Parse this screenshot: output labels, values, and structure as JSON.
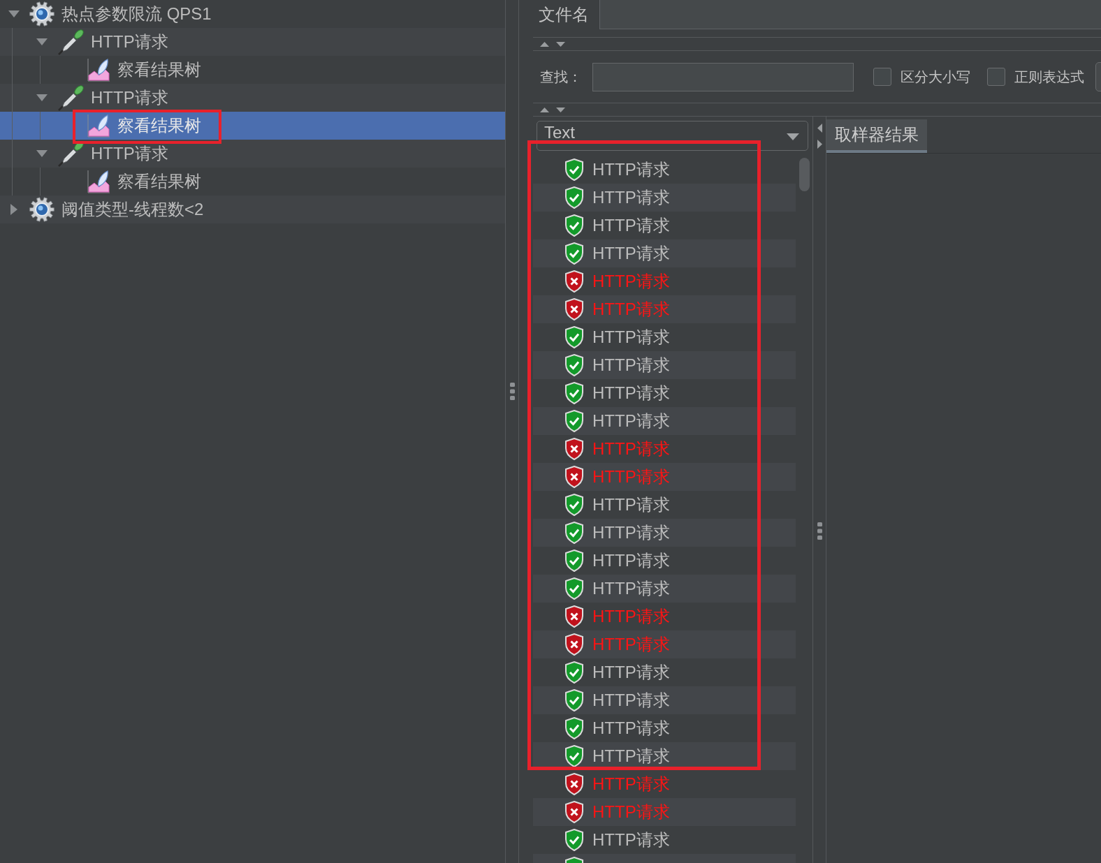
{
  "tree": {
    "items": [
      {
        "kind": "thread-group",
        "label": "热点参数限流 QPS1",
        "expanded": true,
        "selected": false,
        "annotated": false,
        "children": [
          {
            "kind": "http-request",
            "label": "HTTP请求",
            "expanded": true,
            "selected": false,
            "annotated": false,
            "children": [
              {
                "kind": "result-tree",
                "label": "察看结果树",
                "selected": false,
                "annotated": false
              }
            ]
          },
          {
            "kind": "http-request",
            "label": "HTTP请求",
            "expanded": true,
            "selected": false,
            "annotated": false,
            "children": [
              {
                "kind": "result-tree",
                "label": "察看结果树",
                "selected": true,
                "annotated": true
              }
            ]
          },
          {
            "kind": "http-request",
            "label": "HTTP请求",
            "expanded": true,
            "selected": false,
            "annotated": false,
            "children": [
              {
                "kind": "result-tree",
                "label": "察看结果树",
                "selected": false,
                "annotated": false
              }
            ]
          }
        ]
      },
      {
        "kind": "thread-group",
        "label": "阈值类型-线程数<2",
        "expanded": false,
        "selected": false,
        "annotated": false
      }
    ]
  },
  "file_panel": {
    "label": "文件名"
  },
  "search": {
    "label": "查找：",
    "options": [
      {
        "label": "区分大小写",
        "checked": false
      },
      {
        "label": "正则表达式",
        "checked": false
      }
    ]
  },
  "renderer_select": {
    "value": "Text"
  },
  "results": {
    "annotated": true,
    "rows": [
      {
        "label": "HTTP请求",
        "failed": false
      },
      {
        "label": "HTTP请求",
        "failed": false
      },
      {
        "label": "HTTP请求",
        "failed": false
      },
      {
        "label": "HTTP请求",
        "failed": false
      },
      {
        "label": "HTTP请求",
        "failed": true
      },
      {
        "label": "HTTP请求",
        "failed": true
      },
      {
        "label": "HTTP请求",
        "failed": false
      },
      {
        "label": "HTTP请求",
        "failed": false
      },
      {
        "label": "HTTP请求",
        "failed": false
      },
      {
        "label": "HTTP请求",
        "failed": false
      },
      {
        "label": "HTTP请求",
        "failed": true
      },
      {
        "label": "HTTP请求",
        "failed": true
      },
      {
        "label": "HTTP请求",
        "failed": false
      },
      {
        "label": "HTTP请求",
        "failed": false
      },
      {
        "label": "HTTP请求",
        "failed": false
      },
      {
        "label": "HTTP请求",
        "failed": false
      },
      {
        "label": "HTTP请求",
        "failed": true
      },
      {
        "label": "HTTP请求",
        "failed": true
      },
      {
        "label": "HTTP请求",
        "failed": false
      },
      {
        "label": "HTTP请求",
        "failed": false
      },
      {
        "label": "HTTP请求",
        "failed": false
      },
      {
        "label": "HTTP请求",
        "failed": false
      },
      {
        "label": "HTTP请求",
        "failed": true
      },
      {
        "label": "HTTP请求",
        "failed": true
      },
      {
        "label": "HTTP请求",
        "failed": false
      },
      {
        "failed": false
      }
    ]
  },
  "tabs": [
    {
      "label": "取样器结果",
      "selected": true
    }
  ]
}
